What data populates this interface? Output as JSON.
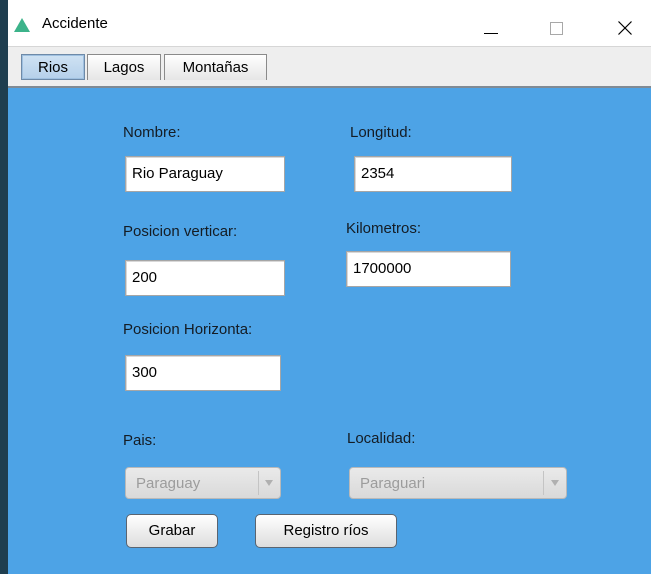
{
  "window": {
    "title": "Accidente",
    "icon": "green-triangle-app-icon"
  },
  "tabs": [
    {
      "label": "Rios",
      "active": true
    },
    {
      "label": "Lagos",
      "active": false
    },
    {
      "label": "Montañas",
      "active": false
    }
  ],
  "form": {
    "nombre_label": "Nombre:",
    "nombre_value": "Rio Paraguay",
    "longitud_label": "Longitud:",
    "longitud_value": "2354",
    "posicion_vertical_label": "Posicion verticar:",
    "posicion_vertical_value": "200",
    "kilometros_label": "Kilometros:",
    "kilometros_value": "1700000",
    "posicion_horizontal_label": "Posicion Horizonta:",
    "posicion_horizontal_value": "300",
    "pais_label": "Pais:",
    "pais_value": "Paraguay",
    "localidad_label": "Localidad:",
    "localidad_value": "Paraguari"
  },
  "buttons": {
    "grabar": "Grabar",
    "registro": "Registro ríos"
  },
  "colors": {
    "panel_background": "#4da3e6",
    "active_tab": "#b5d0ea",
    "app_icon": "#3cb38a"
  }
}
